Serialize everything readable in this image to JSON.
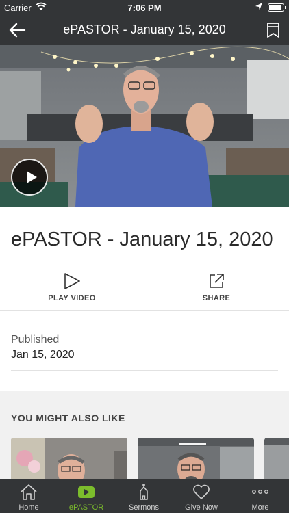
{
  "status_bar": {
    "carrier": "Carrier",
    "time": "7:06 PM"
  },
  "nav": {
    "title": "ePASTOR - January 15, 2020",
    "back_icon": "arrow-left-icon",
    "bookmark_icon": "bookmark-icon"
  },
  "video": {
    "play_icon": "play-icon"
  },
  "content": {
    "title": "ePASTOR - January 15, 2020",
    "actions": [
      {
        "label": "PLAY VIDEO",
        "icon": "play-outline-icon"
      },
      {
        "label": "SHARE",
        "icon": "share-icon"
      }
    ],
    "published_label": "Published",
    "published_value": "Jan 15, 2020"
  },
  "related": {
    "heading": "YOU MIGHT ALSO LIKE"
  },
  "tabbar": {
    "active_color": "#7cbd2c",
    "tabs": [
      {
        "label": "Home",
        "icon": "home-icon",
        "active": false
      },
      {
        "label": "ePASTOR",
        "icon": "youtube-play-icon",
        "active": true
      },
      {
        "label": "Sermons",
        "icon": "church-icon",
        "active": false
      },
      {
        "label": "Give Now",
        "icon": "heart-icon",
        "active": false
      },
      {
        "label": "More",
        "icon": "more-dots-icon",
        "active": false
      }
    ]
  }
}
